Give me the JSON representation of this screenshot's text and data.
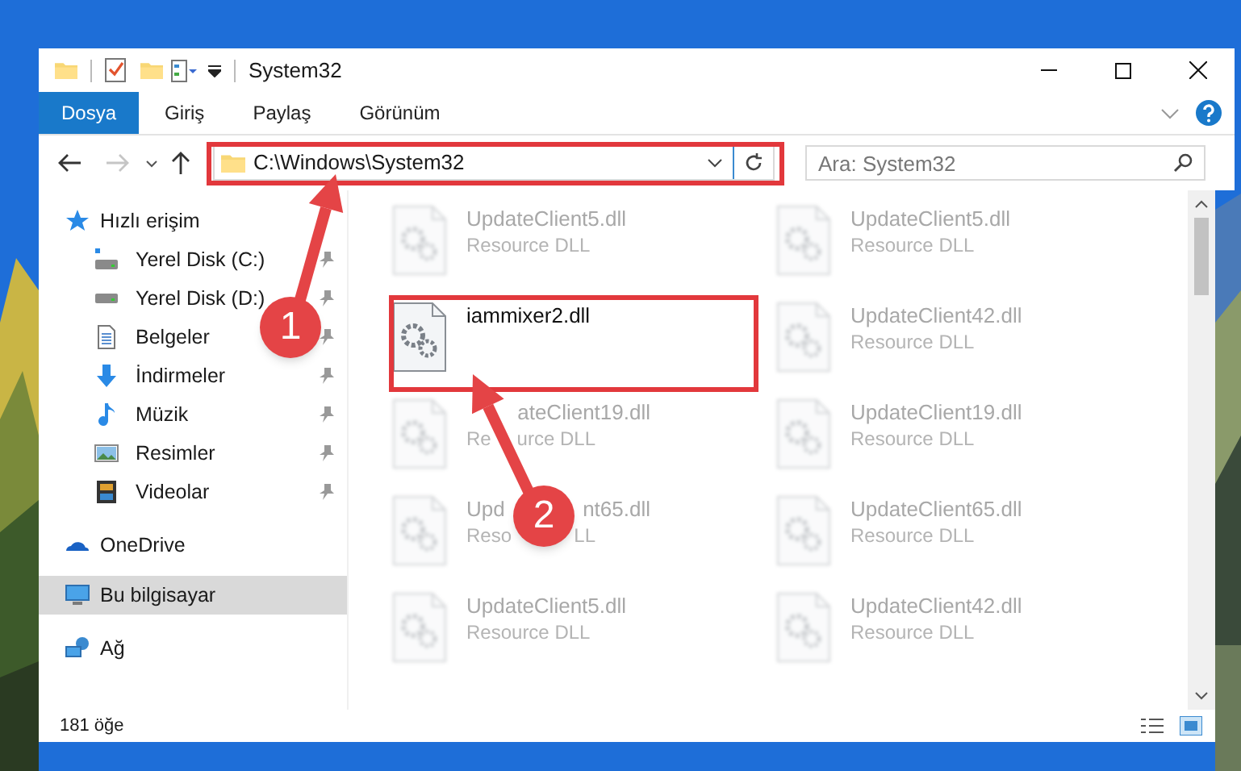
{
  "window": {
    "title": "System32"
  },
  "ribbon_tabs": [
    {
      "label": "Dosya",
      "selected": true
    },
    {
      "label": "Giriş",
      "selected": false
    },
    {
      "label": "Paylaş",
      "selected": false
    },
    {
      "label": "Görünüm",
      "selected": false
    }
  ],
  "navigation": {
    "forward_disabled": true
  },
  "address_bar": {
    "path": "C:\\Windows\\System32"
  },
  "search": {
    "placeholder": "Ara: System32"
  },
  "sidebar": {
    "items": [
      {
        "label": "Hızlı erişim",
        "kind": "quick-access",
        "selected": false,
        "children": [
          {
            "label": "Yerel Disk (C:)",
            "kind": "drive-c",
            "selected": false,
            "pinned": true
          },
          {
            "label": "Yerel Disk (D:)",
            "kind": "drive",
            "selected": false,
            "pinned": true
          },
          {
            "label": "Belgeler",
            "kind": "documents",
            "selected": false,
            "pinned": true
          },
          {
            "label": "İndirmeler",
            "kind": "downloads",
            "selected": false,
            "pinned": true
          },
          {
            "label": "Müzik",
            "kind": "music",
            "selected": false,
            "pinned": true
          },
          {
            "label": "Resimler",
            "kind": "pictures",
            "selected": false,
            "pinned": true
          },
          {
            "label": "Videolar",
            "kind": "videos",
            "selected": false,
            "pinned": true
          }
        ]
      },
      {
        "label": "OneDrive",
        "kind": "cloud",
        "selected": false
      },
      {
        "label": "Bu bilgisayar",
        "kind": "computer",
        "selected": true
      },
      {
        "label": "Ağ",
        "kind": "network",
        "selected": false
      }
    ]
  },
  "files": [
    {
      "name": "UpdateClient5.dll",
      "type": "Resource DLL",
      "dimmed": true
    },
    {
      "name": "UpdateClient5.dll",
      "type": "Resource DLL",
      "dimmed": true
    },
    {
      "name": "iammixer2.dll",
      "dimmed": false
    },
    {
      "name": "UpdateClient42.dll",
      "type": "Resource DLL",
      "dimmed": true
    },
    {
      "name": [
        "ateClient19.dll"
      ],
      "type": [
        "Re",
        "urce DLL"
      ],
      "dimmed": true
    },
    {
      "name": "UpdateClient19.dll",
      "type": "Resource DLL",
      "dimmed": true
    },
    {
      "name": [
        "Upd",
        "nt65.dll"
      ],
      "type": [
        "Reso",
        "LL"
      ],
      "dimmed": true
    },
    {
      "name": "UpdateClient65.dll",
      "type": "Resource DLL",
      "dimmed": true
    },
    {
      "name": "UpdateClient5.dll",
      "type": "Resource DLL",
      "dimmed": true
    },
    {
      "name": "UpdateClient42.dll",
      "type": "Resource DLL",
      "dimmed": true
    }
  ],
  "status_bar": {
    "item_count": "181 öğe"
  },
  "annotations": [
    {
      "number": "1"
    },
    {
      "number": "2"
    }
  ]
}
